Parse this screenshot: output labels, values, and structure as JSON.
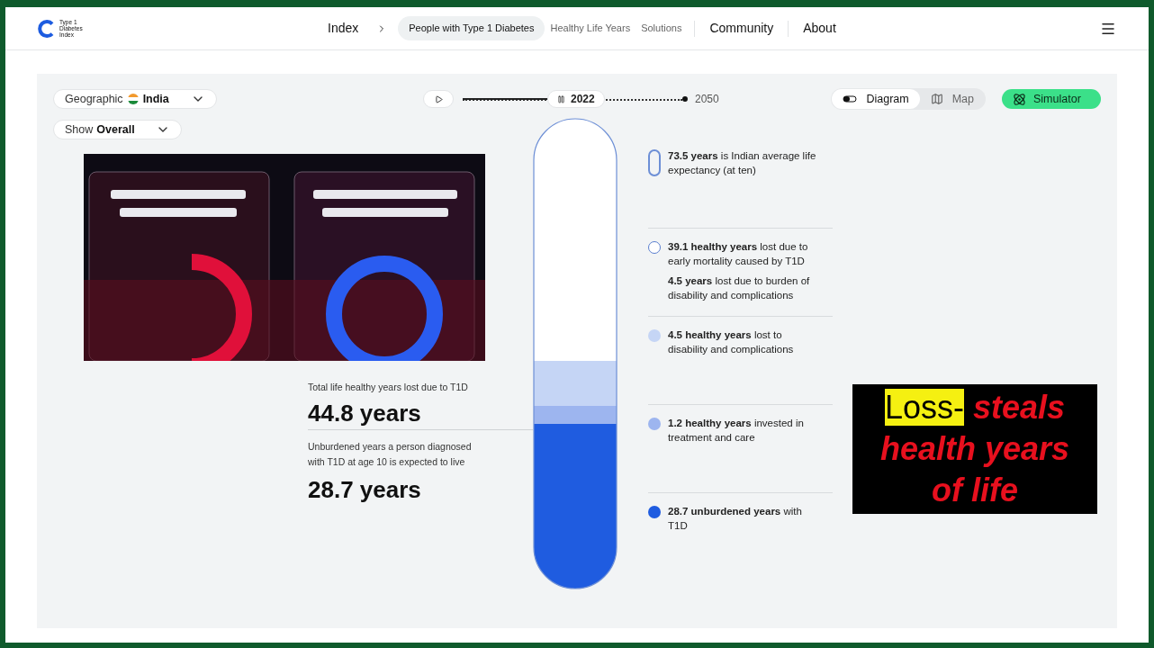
{
  "header": {
    "logo_lines": [
      "Type 1",
      "Diabetes",
      "Index"
    ],
    "nav": [
      {
        "label": "Index",
        "kind": "main",
        "selected": false
      },
      {
        "label": "People with Type 1 Diabetes",
        "kind": "sub",
        "selected": true
      },
      {
        "label": "Healthy Life Years",
        "kind": "sub",
        "selected": false
      },
      {
        "label": "Solutions",
        "kind": "sub",
        "selected": false
      },
      {
        "label": "Community",
        "kind": "main",
        "selected": false
      },
      {
        "label": "About",
        "kind": "main",
        "selected": false
      }
    ]
  },
  "filters": [
    {
      "label": "Geographic",
      "value": "India",
      "flag": true
    },
    {
      "label": "Show",
      "value": "Overall",
      "flag": false
    }
  ],
  "timeline": {
    "current": "2022",
    "end": "2050",
    "level": 0.4
  },
  "views": [
    {
      "label": "Diagram",
      "selected": true
    },
    {
      "label": "Map",
      "selected": false
    }
  ],
  "simulator": "Simulator",
  "stats": [
    {
      "label": "Total life healthy years lost due to T1D",
      "value": "44.8 years"
    },
    {
      "label": "Unburdened years a person diagnosed with T1D at age 10 is expected to live",
      "value": "28.7 years"
    }
  ],
  "legend": [
    {
      "kind": "pill",
      "color": "#6d8fd6",
      "text": "**73.5 years** is Indian average life expectancy (at ten)"
    },
    {
      "kind": "ring",
      "color": "#5b7fcf",
      "text": "**39.1 healthy years** lost due to early mortality caused by T1D",
      "note": "**4.5 years** lost due to burden of disability and complications"
    },
    {
      "kind": "dot",
      "color": "#c5d5f5",
      "text": "**4.5 healthy years** lost to disability and complications"
    },
    {
      "kind": "dot",
      "color": "#9db5ef",
      "text": "**1.2 healthy years** invested in treatment and care"
    },
    {
      "kind": "dot",
      "color": "#1f5ce0",
      "text": "**28.7 unburdened years** with T1D"
    }
  ],
  "caption": {
    "highlight": "Loss-",
    "text": "steals health years of life"
  }
}
